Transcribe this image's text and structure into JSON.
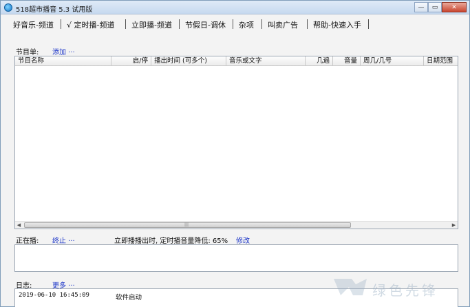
{
  "window": {
    "title": "518超市播音 5.3 试用版",
    "buttons": [
      "minimize",
      "maximize",
      "close"
    ]
  },
  "tabs": [
    {
      "label": "好音乐-频道"
    },
    {
      "label": "√ 定时播-频道",
      "active": true
    },
    {
      "label": "立即播-频道"
    },
    {
      "label": "节假日-调休"
    },
    {
      "label": "杂项"
    },
    {
      "label": "叫卖广告"
    },
    {
      "label": "帮助-快速入手"
    }
  ],
  "program": {
    "label": "节目单:",
    "add_link": "添加 ···",
    "columns": [
      "节目名称",
      "启/停",
      "播出时间 (可多个)",
      "音乐或文字",
      "几遍",
      "音量",
      "周几/几号",
      "日期范围"
    ]
  },
  "playing": {
    "label": "正在播:",
    "stop_link": "终止 ···",
    "volume_note": "立即播播出时, 定时播音量降低: 65%",
    "modify_link": "修改"
  },
  "log": {
    "label": "日志:",
    "more_link": "更多 ···",
    "entries": [
      {
        "time": "2019-06-10 16:45:09",
        "message": "软件启动"
      }
    ]
  },
  "watermark": "绿色先锋"
}
